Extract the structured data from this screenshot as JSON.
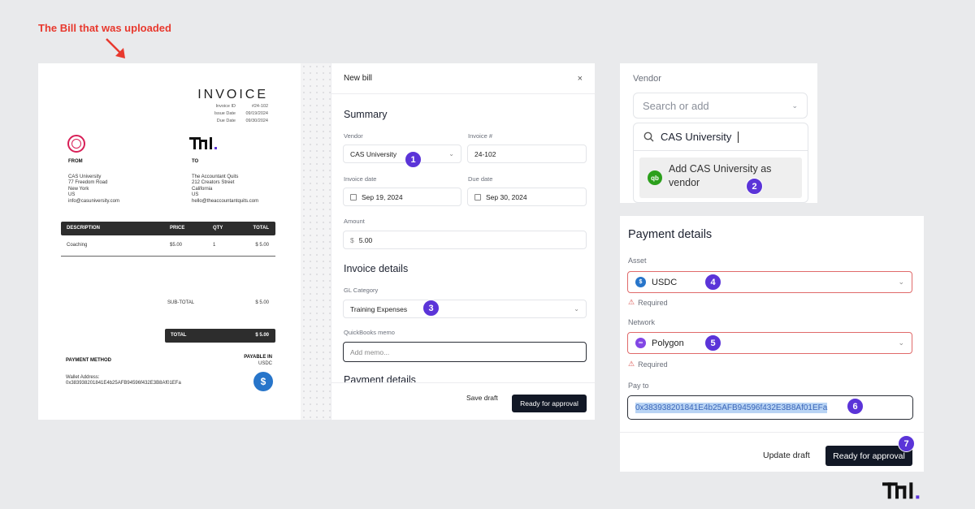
{
  "annotation": {
    "title": "The Bill that was uploaded"
  },
  "invoice": {
    "title": "INVOICE",
    "meta": [
      {
        "label": "Invoice ID",
        "value": "#24-102"
      },
      {
        "label": "Issue Date",
        "value": "09/19/2024"
      },
      {
        "label": "Due Date",
        "value": "09/30/2024"
      }
    ],
    "from": {
      "heading": "FROM",
      "lines": [
        "CAS University",
        "77 Freedom Road",
        "New York",
        "US",
        "info@casuniversity.com"
      ]
    },
    "to": {
      "heading": "TO",
      "lines": [
        "The Accountant Quits",
        "212 Creators Street",
        "California",
        "US",
        "hello@theaccountantquits.com"
      ]
    },
    "table": {
      "headers": [
        "DESCRIPTION",
        "PRICE",
        "QTY",
        "TOTAL"
      ],
      "rows": [
        [
          "Coaching",
          "$5.00",
          "1",
          "$ 5.00"
        ]
      ]
    },
    "subtotal_label": "SUB-TOTAL",
    "subtotal_value": "$ 5.00",
    "total_label": "TOTAL",
    "total_value": "$ 5.00",
    "payment_method": "PAYMENT METHOD",
    "wallet_label": "Wallet Address:",
    "wallet_address": "0x383938201841E4b25AFB94596f432E3B8Af01EFa",
    "payable_in": "PAYABLE IN",
    "payable_asset": "USDC",
    "logo_text": "TA1."
  },
  "bill": {
    "header": "New bill",
    "close": "×",
    "summary_title": "Summary",
    "vendor_label": "Vendor",
    "vendor_value": "CAS University",
    "invoice_no_label": "Invoice #",
    "invoice_no_value": "24-102",
    "invoice_date_label": "Invoice date",
    "invoice_date_value": "Sep 19, 2024",
    "due_date_label": "Due date",
    "due_date_value": "Sep 30, 2024",
    "amount_label": "Amount",
    "amount_currency": "$",
    "amount_value": "5.00",
    "details_title": "Invoice details",
    "gl_label": "GL Category",
    "gl_value": "Training Expenses",
    "memo_label": "QuickBooks memo",
    "memo_placeholder": "Add memo...",
    "payment_title_partial": "Payment details",
    "save_draft": "Save draft",
    "ready": "Ready for approval"
  },
  "vendor_popup": {
    "label": "Vendor",
    "placeholder": "Search or add",
    "search_value": "CAS University",
    "add_text": "Add CAS University as vendor",
    "qb_icon": "qb"
  },
  "payment": {
    "title": "Payment details",
    "asset_label": "Asset",
    "asset_value": "USDC",
    "network_label": "Network",
    "network_value": "Polygon",
    "required": "Required",
    "pay_to_label": "Pay to",
    "pay_to_value": "0x383938201841E4b25AFB94596f432E3B8Af01EFa",
    "update_draft": "Update draft",
    "ready": "Ready for approval"
  },
  "steps": [
    "1",
    "2",
    "3",
    "4",
    "5",
    "6",
    "7"
  ],
  "brand_logo": "TA1.",
  "colors": {
    "accent": "#5b34d8",
    "dark_button": "#121826",
    "error": "#e06a6a",
    "annotation": "#e8392e"
  }
}
